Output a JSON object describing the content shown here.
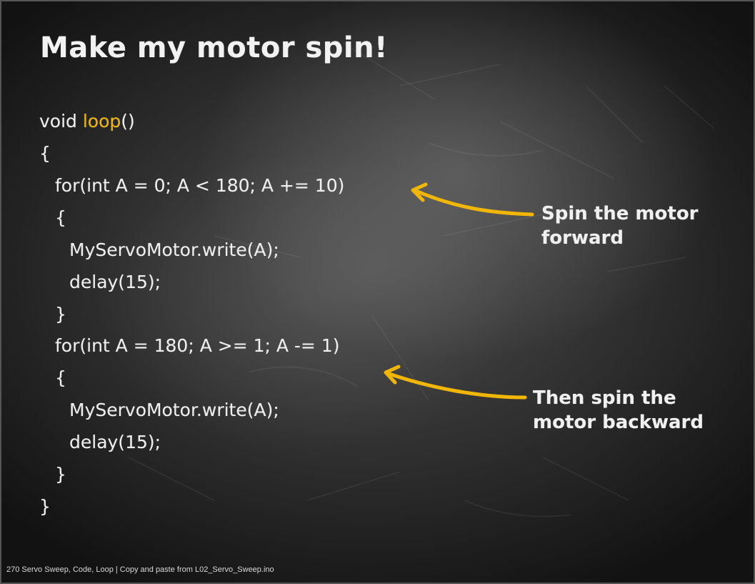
{
  "slide": {
    "title": "Make my motor spin!",
    "code": {
      "line1_kw": "void ",
      "line1_fn": "loop",
      "line1_end": "()",
      "line2": "{",
      "line3": "for(int A = 0; A < 180; A += 10)",
      "line4": "{",
      "line5": "MyServoMotor.write(A);",
      "line6": "delay(15);",
      "line7": "}",
      "line8": "for(int A = 180; A >= 1; A -= 1)",
      "line9": "{",
      "line10": "MyServoMotor.write(A);",
      "line11": "delay(15);",
      "line12": "}",
      "line13": "}"
    },
    "annotations": {
      "forward": [
        "Spin the motor",
        "forward"
      ],
      "backward": [
        "Then spin the",
        "motor backward"
      ]
    },
    "footer": "270 Servo Sweep, Code, Loop | Copy and paste from L02_Servo_Sweep.ino",
    "colors": {
      "accent": "#f2b705",
      "text": "#efefef",
      "background": "#333333"
    }
  }
}
